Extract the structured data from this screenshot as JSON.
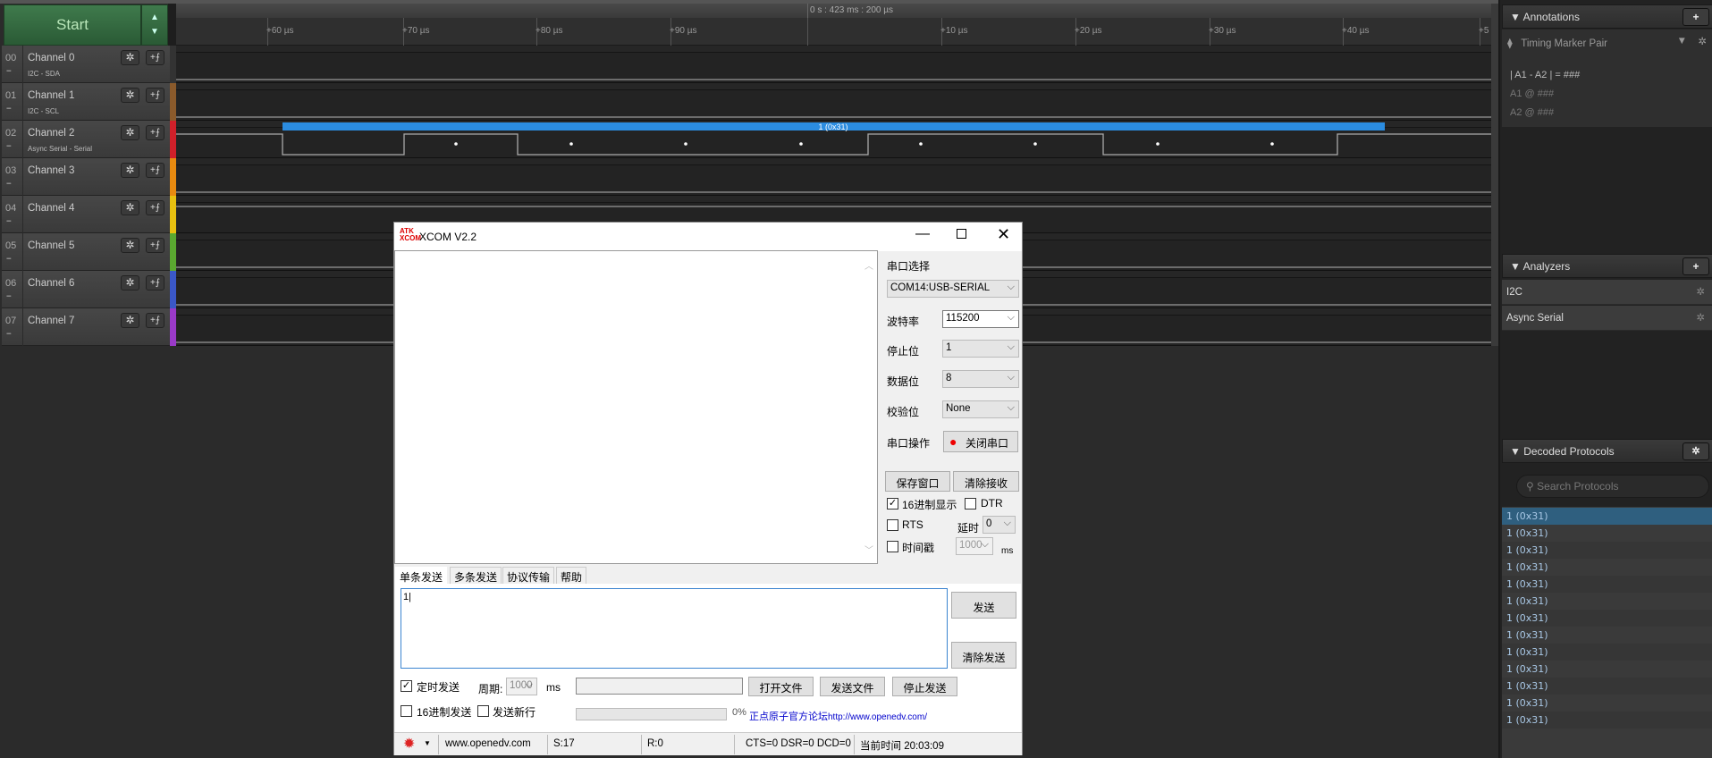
{
  "logic": {
    "start_label": "Start",
    "time_marker": "0 s : 423 ms : 200 µs",
    "ticks": [
      "+60 µs",
      "+70 µs",
      "+80 µs",
      "+90 µs",
      "+10 µs",
      "+20 µs",
      "+30 µs",
      "+40 µs",
      "+5"
    ],
    "channels": [
      {
        "num": "00",
        "name": "Channel 0",
        "sub": "I2C - SDA",
        "color": "#333333"
      },
      {
        "num": "01",
        "name": "Channel 1",
        "sub": "I2C - SCL",
        "color": "#8a5a2b"
      },
      {
        "num": "02",
        "name": "Channel 2",
        "sub": "Async Serial - Serial",
        "color": "#d0202a"
      },
      {
        "num": "03",
        "name": "Channel 3",
        "sub": "",
        "color": "#e88a10"
      },
      {
        "num": "04",
        "name": "Channel 4",
        "sub": "",
        "color": "#e8c010"
      },
      {
        "num": "05",
        "name": "Channel 5",
        "sub": "",
        "color": "#5aa830"
      },
      {
        "num": "06",
        "name": "Channel 6",
        "sub": "",
        "color": "#3a58c8"
      },
      {
        "num": "07",
        "name": "Channel 7",
        "sub": "",
        "color": "#9a3ac8"
      }
    ],
    "decode_bubble": "1 (0x31)"
  },
  "annotations": {
    "title": "Annotations",
    "marker_type": "Timing Marker Pair",
    "line1": "| A1 - A2 | = ###",
    "line2": "A1  @  ###",
    "line3": "A2  @  ###"
  },
  "analyzers": {
    "title": "Analyzers",
    "items": [
      "I2C",
      "Async Serial"
    ]
  },
  "decoded": {
    "title": "Decoded Protocols",
    "search_placeholder": "Search Protocols",
    "items": [
      "1 (0x31)",
      "1 (0x31)",
      "1 (0x31)",
      "1 (0x31)",
      "1 (0x31)",
      "1 (0x31)",
      "1 (0x31)",
      "1 (0x31)",
      "1 (0x31)",
      "1 (0x31)",
      "1 (0x31)",
      "1 (0x31)",
      "1 (0x31)"
    ]
  },
  "xcom": {
    "title": "XCOM V2.2",
    "port_label": "串口选择",
    "port_value": "COM14:USB-SERIAL",
    "baud_label": "波特率",
    "baud_value": "115200",
    "stop_label": "停止位",
    "stop_value": "1",
    "data_label": "数据位",
    "data_value": "8",
    "parity_label": "校验位",
    "parity_value": "None",
    "op_label": "串口操作",
    "op_button": "关闭串口",
    "save_window": "保存窗口",
    "clear_recv": "清除接收",
    "hex_display": "16进制显示",
    "dtr": "DTR",
    "rts": "RTS",
    "delay_label": "延时",
    "delay_value": "0",
    "timestamp": "时间戳",
    "timestamp_value": "1000",
    "ms": "ms",
    "tabs": [
      "单条发送",
      "多条发送",
      "协议传输",
      "帮助"
    ],
    "send_text": "1",
    "send_btn": "发送",
    "clear_send": "清除发送",
    "timed_send": "定时发送",
    "period_label": "周期:",
    "period_value": "1000",
    "period_unit": "ms",
    "open_file": "打开文件",
    "send_file": "发送文件",
    "stop_send": "停止发送",
    "hex_send": "16进制发送",
    "send_newline": "发送新行",
    "progress": "0%",
    "forum": "正点原子官方论坛",
    "forum_url": "http://www.openedv.com/",
    "status": {
      "site": "www.openedv.com",
      "s": "S:17",
      "r": "R:0",
      "lines": "CTS=0 DSR=0 DCD=0",
      "time": "当前时间 20:03:09"
    }
  }
}
